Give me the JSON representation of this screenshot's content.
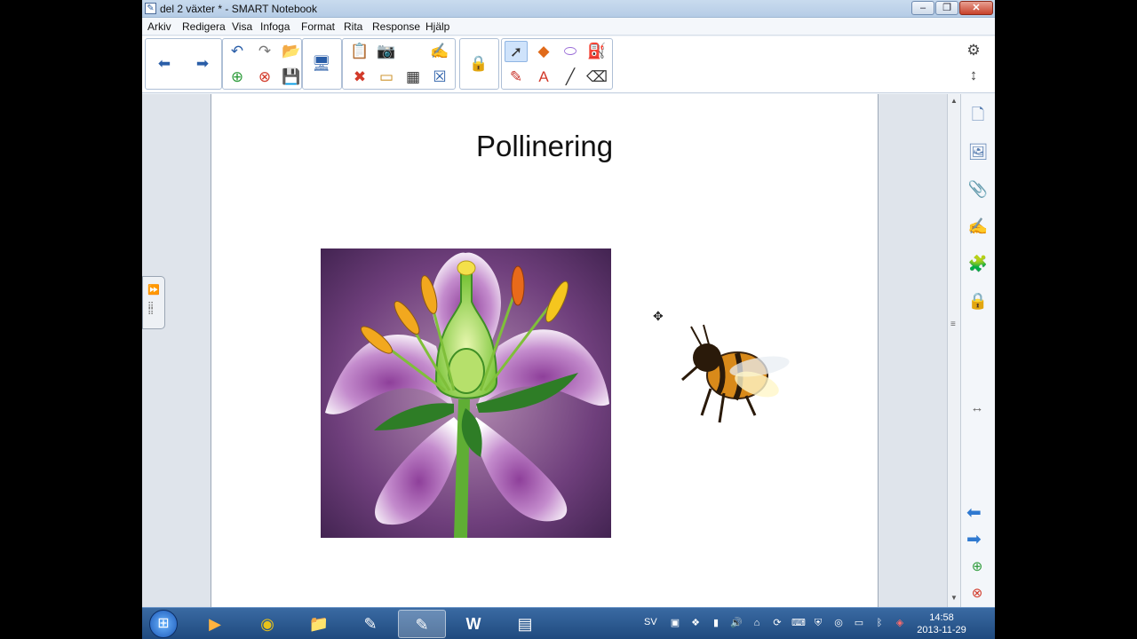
{
  "window": {
    "title": "del 2 växter * - SMART Notebook",
    "app_icon": "notebook-icon",
    "controls": [
      "minimize-icon",
      "maximize-icon",
      "close-icon"
    ],
    "close_glyph": "✕"
  },
  "menu": {
    "items": [
      "Arkiv",
      "Redigera",
      "Visa",
      "Infoga",
      "Format",
      "Rita",
      "Response",
      "Hjälp"
    ]
  },
  "toolbar": {
    "groups": [
      [
        "back-arrow-icon",
        "forward-arrow-icon"
      ],
      [
        "undo-icon",
        "redo-icon",
        "open-file-icon",
        "add-page-icon",
        "delete-page-icon",
        "save-icon"
      ],
      [
        "display-icon"
      ],
      [
        "paste-icon",
        "screenshot-icon",
        "delete-icon",
        "screen-shade-icon",
        "table-icon",
        "clear-icon",
        "magic-pen-icon"
      ],
      [
        "gallery-lock-icon"
      ],
      [
        "select-icon",
        "shapes-icon",
        "eraser-icon",
        "fill-icon",
        "pens-icon",
        "text-icon",
        "line-icon",
        "eraser-tool-icon"
      ]
    ],
    "settings_icon": "gear-icon",
    "move_toolbar_icon": "updown-arrows-icon"
  },
  "page": {
    "title": "Pollinering",
    "images": [
      {
        "name": "flower-image",
        "subject": "flower-cross-section"
      },
      {
        "name": "bee-image",
        "subject": "bee"
      }
    ]
  },
  "sidebar": {
    "tabs": [
      "page-sorter-icon",
      "gallery-icon",
      "attachments-icon",
      "properties-icon",
      "addons-icon",
      "lesson-activity-icon"
    ],
    "nav": [
      "prev-page-icon",
      "next-page-icon",
      "add-page-icon",
      "delete-page-icon"
    ],
    "resize_icon": "horizontal-resize-icon"
  },
  "taskbar": {
    "start_icon": "windows-start-icon",
    "apps": [
      "media-player-icon",
      "chrome-icon",
      "file-explorer-icon",
      "smart-tools-icon",
      "smart-notebook-icon",
      "word-icon",
      "smart-board-icon"
    ],
    "active_app": "smart-notebook-icon",
    "language": "SV",
    "tray_icons": [
      "network-icon",
      "dropbox-icon",
      "signal-icon",
      "volume-icon",
      "usb-icon",
      "sync-icon",
      "keyboard-icon",
      "shield-icon",
      "wifi-icon",
      "bluetooth-icon",
      "security-icon"
    ],
    "time": "14:58",
    "date": "2013-11-29"
  },
  "colors": {
    "title_bar": "#c9dbee",
    "taskbar": "#2a5a91",
    "flower_purple": "#8e3f9a",
    "accent_blue": "#2f79d0"
  }
}
